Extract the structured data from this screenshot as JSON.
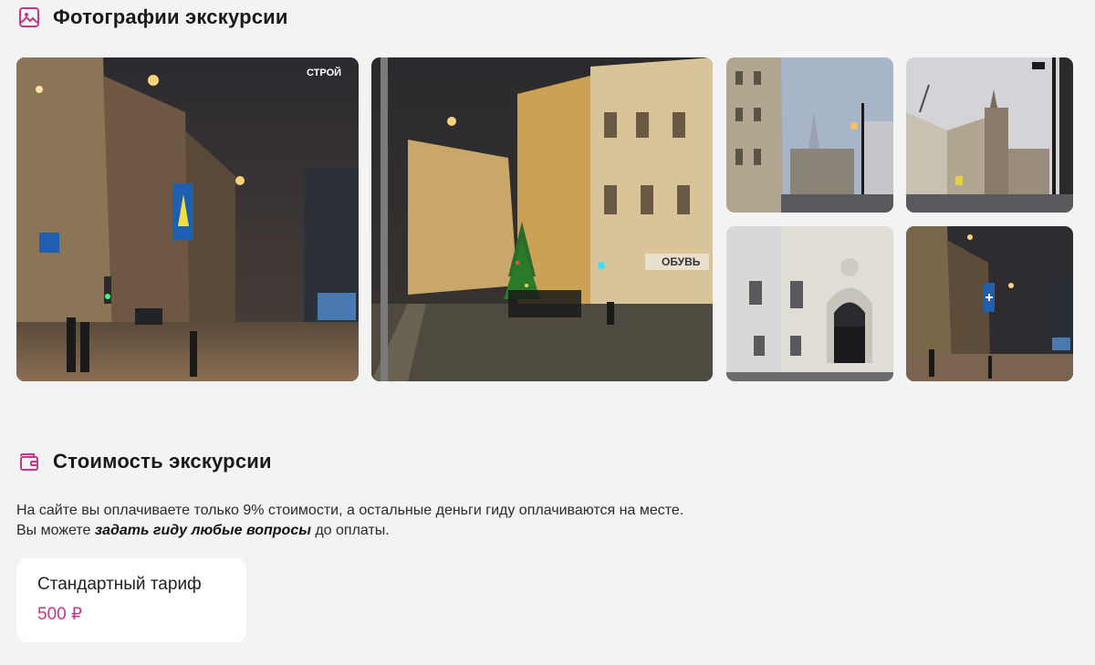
{
  "photos_section": {
    "title": "Фотографии экскурсии",
    "icon": "image-icon",
    "photos": [
      {
        "name": "night-street-crosswalk"
      },
      {
        "name": "christmas-tree-corner",
        "sign_text": "ОБУВЬ"
      },
      {
        "name": "foggy-street-highrise"
      },
      {
        "name": "skyscraper-street-view"
      },
      {
        "name": "white-building-archway"
      },
      {
        "name": "night-street-lights"
      }
    ],
    "store_sign": "СТРОЙ"
  },
  "price_section": {
    "title": "Стоимость экскурсии",
    "icon": "wallet-icon",
    "description_line1": "На сайте вы оплачиваете только 9% стоимости, а остальные деньги гиду оплачиваются на месте.",
    "description_line2_prefix": "Вы можете ",
    "description_link": "задать гиду любые вопросы",
    "description_line2_suffix": " до оплаты.",
    "tariff": {
      "name": "Стандартный тариф",
      "price": "500 ₽"
    }
  },
  "colors": {
    "accent": "#c0388a",
    "background": "#f3f3f3",
    "card": "#ffffff"
  }
}
